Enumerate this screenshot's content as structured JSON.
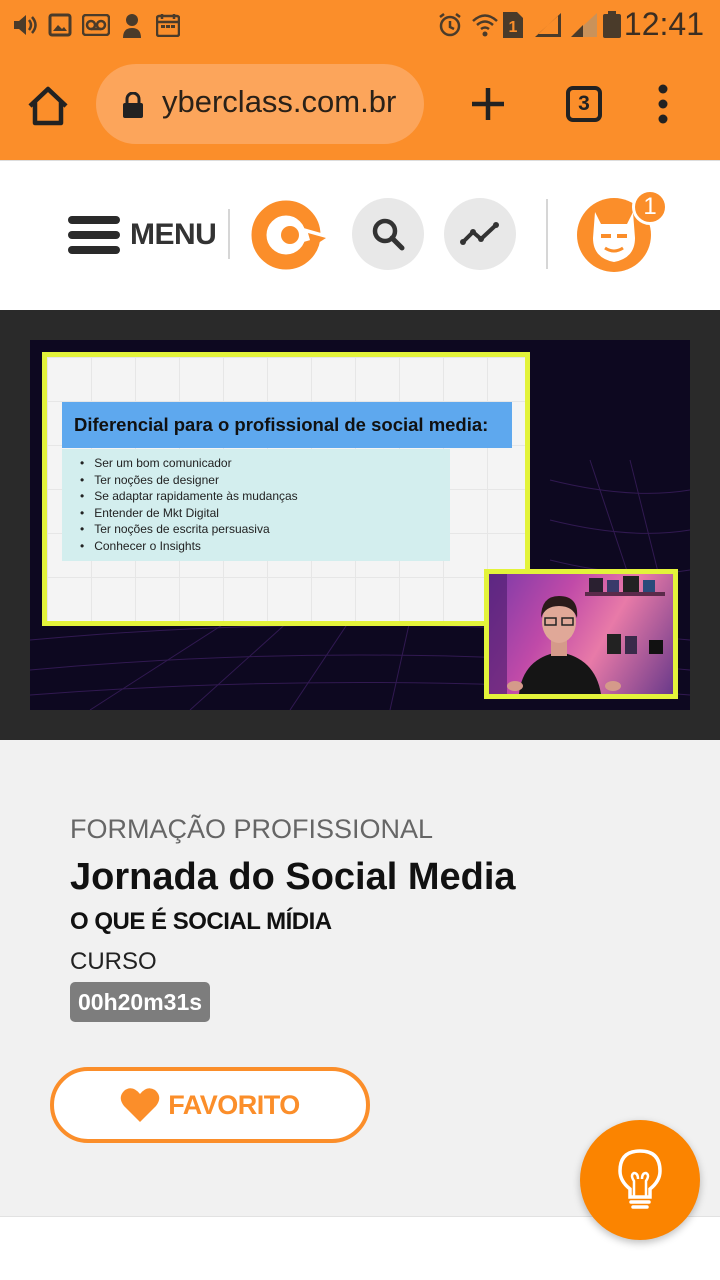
{
  "status_bar": {
    "time": "12:41",
    "sim_label": "1",
    "icons": [
      "volume-icon",
      "image-icon",
      "voicemail-icon",
      "spy-icon",
      "calendar-icon",
      "alarm-icon",
      "wifi-icon",
      "sim-icon",
      "signal-icon",
      "signal-weak-icon",
      "battery-icon"
    ]
  },
  "browser": {
    "url": "yberclass.com.br",
    "tab_count": "3",
    "icons": [
      "home-icon",
      "lock-icon",
      "plus-icon",
      "more-vertical-icon"
    ]
  },
  "header": {
    "menu_label": "MENU",
    "notification_count": "1",
    "icons": [
      "hamburger-icon",
      "search-icon",
      "trending-icon",
      "batman-avatar-icon"
    ]
  },
  "video": {
    "slide_title": "Diferencial para o profissional de social media:",
    "slide_items": [
      "Ser um bom comunicador",
      "Ter noções de designer",
      "Se adaptar rapidamente às mudanças",
      "Entender de Mkt Digital",
      "Ter noções de escrita persuasiva",
      "Conhecer o Insights"
    ]
  },
  "course": {
    "kicker": "FORMAÇÃO PROFISSIONAL",
    "title": "Jornada do Social Media",
    "subtitle": "O QUE É SOCIAL MÍDIA",
    "type": "CURSO",
    "duration": "00h20m31s",
    "favorite_label": "FAVORITO"
  },
  "colors": {
    "brand_orange": "#fb8e2a",
    "slide_border": "#e3f33a",
    "slide_title_bg": "#5ea8ee"
  }
}
